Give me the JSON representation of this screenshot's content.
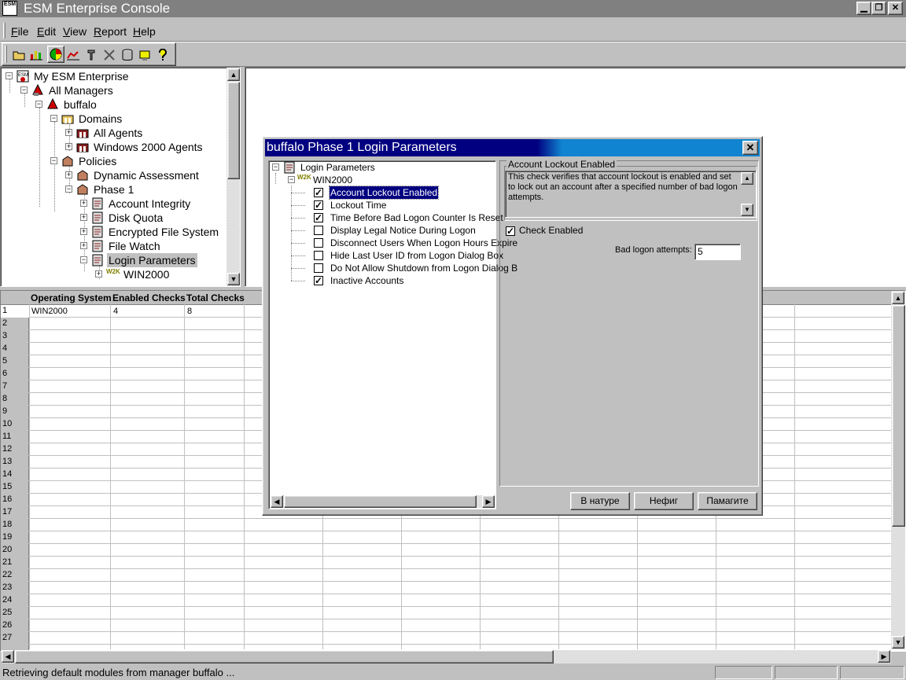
{
  "window": {
    "title": "ESM Enterprise Console",
    "icon_text": "ESM",
    "buttons": [
      "minimize",
      "restore",
      "close"
    ]
  },
  "menu": [
    {
      "key": "F",
      "rest": "ile"
    },
    {
      "key": "E",
      "rest": "dit"
    },
    {
      "key": "V",
      "rest": "iew"
    },
    {
      "key": "R",
      "rest": "eport"
    },
    {
      "key": "H",
      "rest": "elp"
    }
  ],
  "toolbar": [
    "open-folder-icon",
    "bar-chart-icon",
    "pie-chart-icon",
    "line-chart-icon",
    "wrench-icon",
    "tools-icon",
    "database-icon",
    "agent-icon",
    "help-icon"
  ],
  "tree": {
    "root": "My ESM Enterprise",
    "managers": "All Managers",
    "manager": "buffalo",
    "domains": "Domains",
    "domain_items": [
      "All Agents",
      "Windows 2000 Agents"
    ],
    "policies": "Policies",
    "policy_items": [
      "Dynamic Assessment",
      "Phase 1"
    ],
    "phase_items": [
      "Account Integrity",
      "Disk Quota",
      "Encrypted File System",
      "File Watch",
      "Login Parameters"
    ],
    "os": "WIN2000",
    "w2k_badge": "W2K"
  },
  "grid": {
    "headers": [
      "Operating System",
      "Enabled Checks",
      "Total Checks"
    ],
    "row_count": 27,
    "rows": [
      [
        "WIN2000",
        "4",
        "8"
      ]
    ]
  },
  "dialog": {
    "title": "buffalo Phase 1 Login Parameters",
    "close": "✕",
    "tree_root": "Login Parameters",
    "tree_os": "WIN2000",
    "checks": [
      {
        "label": "Account Lockout Enabled",
        "checked": true,
        "selected": true
      },
      {
        "label": "Lockout Time",
        "checked": true
      },
      {
        "label": "Time Before Bad Logon Counter Is Reset",
        "checked": true
      },
      {
        "label": "Display Legal Notice During Logon",
        "checked": false
      },
      {
        "label": "Disconnect Users When Logon Hours Expire",
        "checked": false
      },
      {
        "label": "Hide Last User ID from Logon Dialog Box",
        "checked": false
      },
      {
        "label": "Do Not Allow Shutdown from Logon Dialog B",
        "checked": false
      },
      {
        "label": "Inactive Accounts",
        "checked": true
      }
    ],
    "group_title": "Account Lockout Enabled",
    "description": "This check verifies that account lockout is enabled and set to lock out an account after a specified number of bad logon attempts.",
    "check_enabled_label": "Check Enabled",
    "check_enabled": true,
    "attempts_label": "Bad logon attempts:",
    "attempts_value": "5",
    "buttons": [
      "В натуре",
      "Нефиг",
      "Памагите"
    ]
  },
  "status": {
    "text": "Retrieving default modules from manager buffalo ..."
  }
}
